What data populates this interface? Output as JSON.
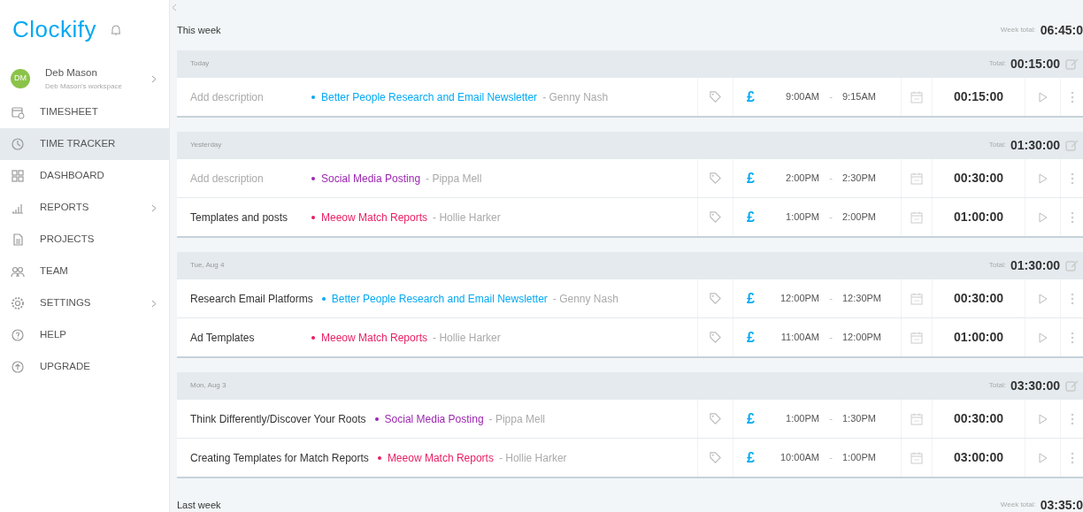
{
  "sidebar": {
    "logo": "Clockify",
    "user": {
      "initials": "DM",
      "name": "Deb Mason",
      "workspace": "Deb Mason's workspace"
    },
    "items": [
      {
        "label": "TIMESHEET",
        "submenu": false,
        "selected": false
      },
      {
        "label": "TIME TRACKER",
        "submenu": false,
        "selected": true
      },
      {
        "label": "DASHBOARD",
        "submenu": false,
        "selected": false
      },
      {
        "label": "REPORTS",
        "submenu": true,
        "selected": false
      },
      {
        "label": "PROJECTS",
        "submenu": false,
        "selected": false
      },
      {
        "label": "TEAM",
        "submenu": false,
        "selected": false
      },
      {
        "label": "SETTINGS",
        "submenu": true,
        "selected": false
      },
      {
        "label": "HELP",
        "submenu": false,
        "selected": false
      },
      {
        "label": "UPGRADE",
        "submenu": false,
        "selected": false
      }
    ]
  },
  "weeks": [
    {
      "title": "This week",
      "total_label": "Week total:",
      "total": "06:45:0",
      "days": [
        {
          "date": "Today",
          "total_label": "Total:",
          "total": "00:15:00",
          "entries": [
            {
              "placeholder": "Add description",
              "project": "Better People Research and Email Newsletter",
              "color": "#03a9f4",
              "client": "- Genny Nash",
              "currency": "£",
              "billable": true,
              "start": "9:00AM",
              "sep": "-",
              "end": "9:15AM",
              "duration": "00:15:00"
            }
          ]
        },
        {
          "date": "Yesterday",
          "total_label": "Total:",
          "total": "01:30:00",
          "entries": [
            {
              "placeholder": "Add description",
              "project": "Social Media Posting",
              "color": "#9c27b0",
              "client": "- Pippa Mell",
              "currency": "£",
              "billable": true,
              "start": "2:00PM",
              "sep": "-",
              "end": "2:30PM",
              "duration": "00:30:00"
            },
            {
              "description": "Templates and posts",
              "project": "Meeow Match Reports",
              "color": "#e91e63",
              "client": "- Hollie Harker",
              "currency": "£",
              "billable": true,
              "start": "1:00PM",
              "sep": "-",
              "end": "2:00PM",
              "duration": "01:00:00"
            }
          ]
        },
        {
          "date": "Tue, Aug 4",
          "total_label": "Total:",
          "total": "01:30:00",
          "entries": [
            {
              "description": "Research Email Platforms",
              "project": "Better People Research and Email Newsletter",
              "color": "#03a9f4",
              "client": "- Genny Nash",
              "currency": "£",
              "billable": true,
              "start": "12:00PM",
              "sep": "-",
              "end": "12:30PM",
              "duration": "00:30:00"
            },
            {
              "description": "Ad Templates",
              "project": "Meeow Match Reports",
              "color": "#e91e63",
              "client": "- Hollie Harker",
              "currency": "£",
              "billable": true,
              "start": "11:00AM",
              "sep": "-",
              "end": "12:00PM",
              "duration": "01:00:00"
            }
          ]
        },
        {
          "date": "Mon, Aug 3",
          "total_label": "Total:",
          "total": "03:30:00",
          "entries": [
            {
              "description": "Think Differently/Discover Your Roots",
              "project": "Social Media Posting",
              "color": "#9c27b0",
              "client": "- Pippa Mell",
              "currency": "£",
              "billable": true,
              "start": "1:00PM",
              "sep": "-",
              "end": "1:30PM",
              "duration": "00:30:00"
            },
            {
              "description": "Creating Templates for Match Reports",
              "project": "Meeow Match Reports",
              "color": "#e91e63",
              "client": "- Hollie Harker",
              "currency": "£",
              "billable": true,
              "start": "10:00AM",
              "sep": "-",
              "end": "1:00PM",
              "duration": "03:00:00"
            }
          ]
        }
      ]
    },
    {
      "title": "Last week",
      "total_label": "Week total:",
      "total": "03:35:0"
    }
  ]
}
